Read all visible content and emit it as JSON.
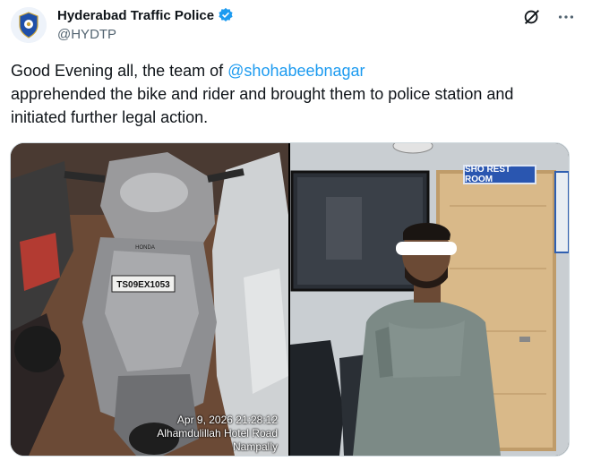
{
  "author": {
    "name": "Hyderabad Traffic Police",
    "handle": "@HYDTP",
    "verified": true,
    "avatar_icon": "police-badge-icon"
  },
  "actions": {
    "grok_icon": "grok-icon",
    "more_icon": "more-dots-icon"
  },
  "tweet": {
    "text_before": "Good Evening all, the team of ",
    "mention": "@shohabeebnagar",
    "line2": "apprehended the bike and rider and brought them to police station and",
    "line3": "initiated further legal action."
  },
  "media": {
    "left_photo": {
      "plate": "TS09EX1053",
      "brand": "HONDA",
      "timestamp": "Apr 9, 2026 21:28:12",
      "location_line1": "Alhamdulillah Hotel Road",
      "location_line2": "Nampally"
    },
    "right_photo": {
      "sign": "SHO REST ROOM"
    }
  },
  "colors": {
    "link": "#1d9bf0",
    "verified": "#1d9bf0",
    "text": "#0f1419",
    "secondary": "#536471"
  }
}
